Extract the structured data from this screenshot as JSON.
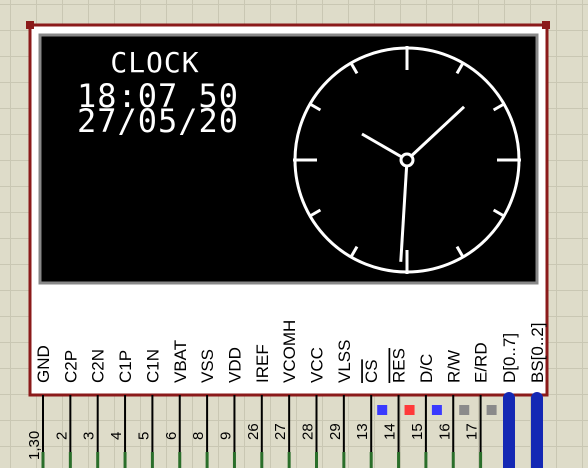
{
  "display": {
    "title": "CLOCK",
    "time": "18:07 50",
    "date": "27/05/20",
    "clock": {
      "hour": 18,
      "minute": 7,
      "second": 50
    }
  },
  "pins": [
    {
      "label": "GND",
      "number": "1,30",
      "overline": false
    },
    {
      "label": "C2P",
      "number": "2",
      "overline": false
    },
    {
      "label": "C2N",
      "number": "3",
      "overline": false
    },
    {
      "label": "C1P",
      "number": "4",
      "overline": false
    },
    {
      "label": "C1N",
      "number": "5",
      "overline": false
    },
    {
      "label": "VBAT",
      "number": "6",
      "overline": false
    },
    {
      "label": "VSS",
      "number": "8",
      "overline": false
    },
    {
      "label": "VDD",
      "number": "9",
      "overline": false
    },
    {
      "label": "IREF",
      "number": "26",
      "overline": false
    },
    {
      "label": "VCOMH",
      "number": "27",
      "overline": false
    },
    {
      "label": "VCC",
      "number": "28",
      "overline": false
    },
    {
      "label": "VLSS",
      "number": "29",
      "overline": false
    },
    {
      "label": "CS",
      "number": "13",
      "overline": true,
      "state": "low"
    },
    {
      "label": "RES",
      "number": "14",
      "overline": true,
      "state": "high"
    },
    {
      "label": "D/C",
      "number": "15",
      "overline": false,
      "state": "low"
    },
    {
      "label": "R/W",
      "number": "16",
      "overline": false,
      "state": "floating"
    },
    {
      "label": "E/RD",
      "number": "17",
      "overline": false,
      "state": "floating"
    }
  ],
  "buses": [
    {
      "label": "D[0..7]"
    },
    {
      "label": "BS[0..2]"
    }
  ],
  "colors": {
    "body": "#ffffff",
    "border": "#8b1a1a",
    "screen": "#000000",
    "pixel": "#ffffff",
    "bus": "#1428b4",
    "wire": "#2a6e2a",
    "state_low": "#3a3aff",
    "state_high": "#ff3a3a",
    "state_floating": "#8a8a8a"
  }
}
